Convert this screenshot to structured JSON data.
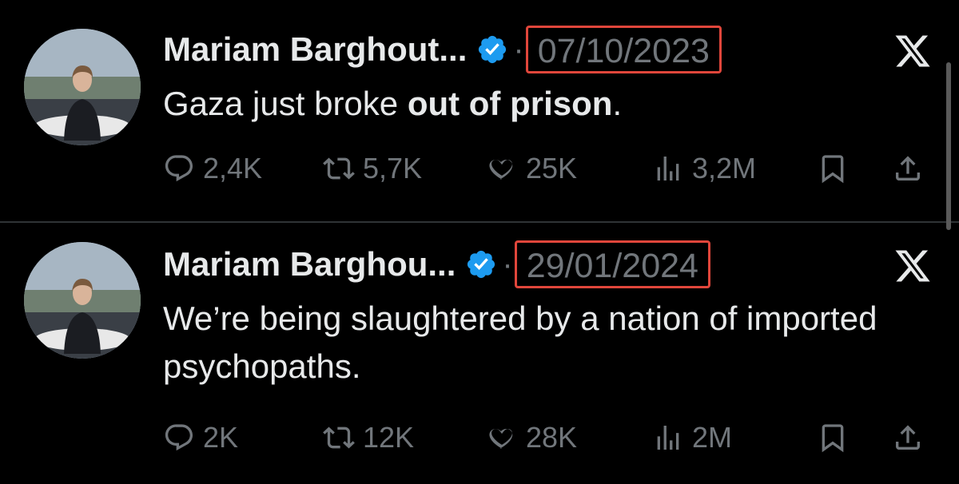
{
  "tweets": [
    {
      "author": "Mariam Barghout...",
      "date": "07/10/2023",
      "text_before": "Gaza just broke ",
      "text_bold": "out of prison",
      "text_after": ".",
      "stats": {
        "replies": "2,4K",
        "reposts": "5,7K",
        "likes": "25K",
        "views": "3,2M"
      }
    },
    {
      "author": "Mariam Barghou...",
      "date": "29/01/2024",
      "text_before": "We’re being slaughtered by a nation of imported psychopaths.",
      "text_bold": "",
      "text_after": "",
      "stats": {
        "replies": "2K",
        "reposts": "12K",
        "likes": "28K",
        "views": "2M"
      }
    }
  ],
  "separator": "·",
  "colors": {
    "background": "#000000",
    "text": "#e7e9ea",
    "muted": "#71767b",
    "verified": "#1d9bf0",
    "highlight_box": "#e0463b"
  },
  "icons": [
    "verified-badge-icon",
    "x-logo-icon",
    "reply-icon",
    "repost-icon",
    "like-icon",
    "views-icon",
    "bookmark-icon",
    "share-icon"
  ]
}
